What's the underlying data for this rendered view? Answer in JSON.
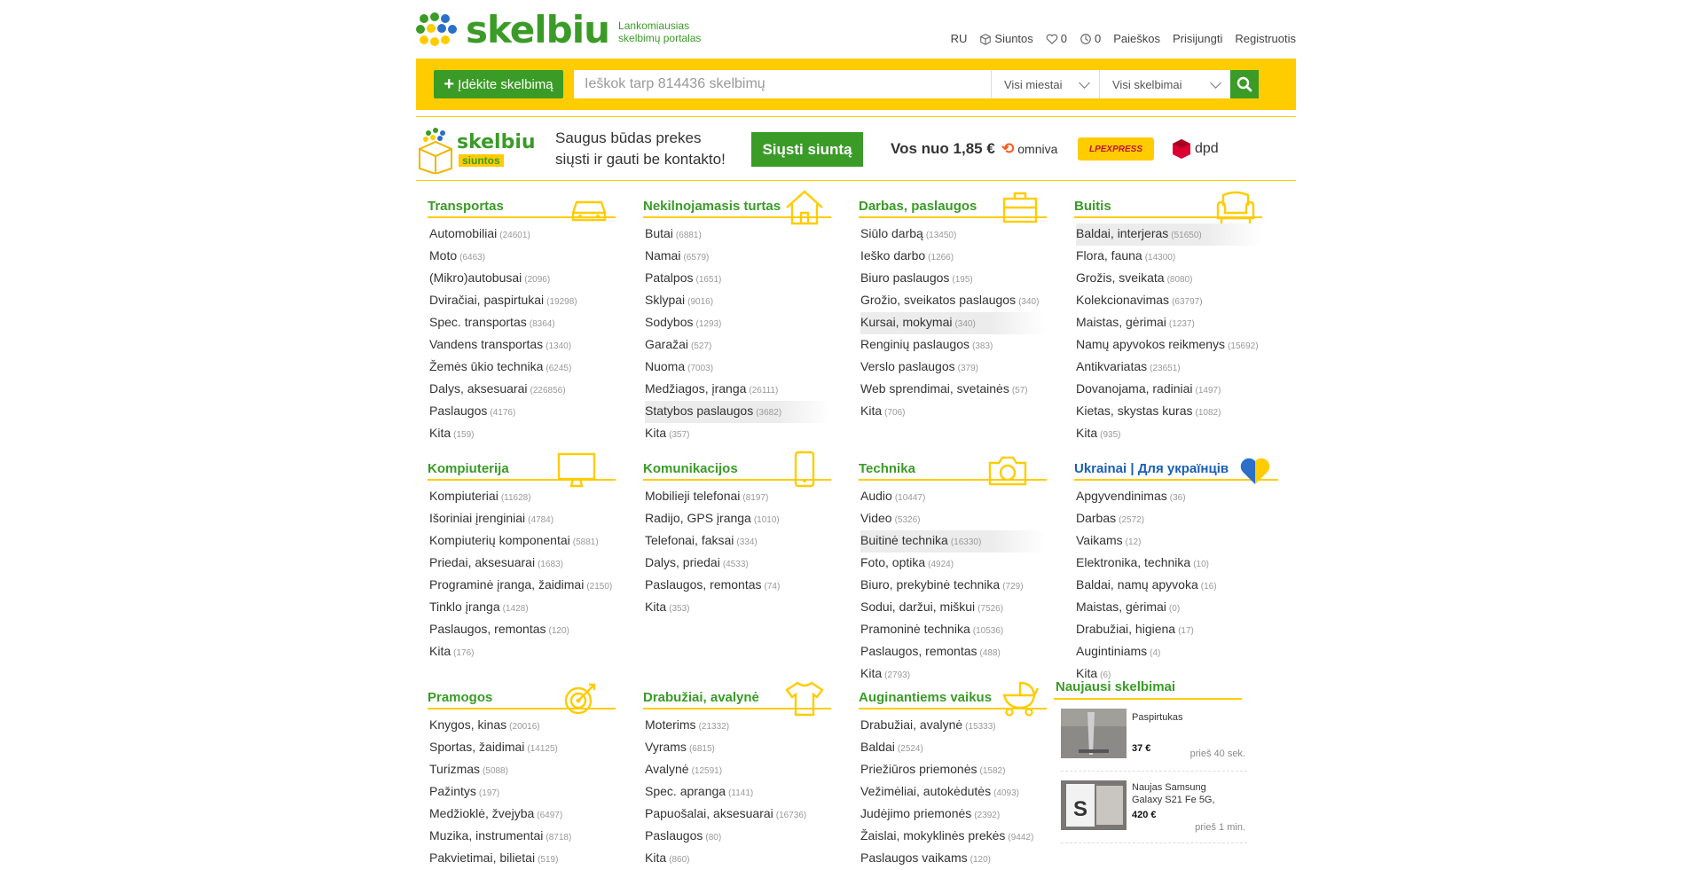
{
  "header": {
    "logo_text": "skelbiu",
    "tagline_1": "Lankomiausias",
    "tagline_2": "skelbimų portalas",
    "nav": {
      "lang": "RU",
      "siuntos": "Siuntos",
      "favorites_count": "0",
      "history_count": "0",
      "searches": "Paieškos",
      "login": "Prisijungti",
      "register": "Registruotis"
    }
  },
  "search": {
    "post_label": "Įdėkite skelbimą",
    "placeholder": "Ieškok tarp 814436 skelbimų",
    "city_select": "Visi miestai",
    "type_select": "Visi skelbimai"
  },
  "promo": {
    "logo_text": "skelbiu",
    "logo_badge": "siuntos",
    "text_1": "Saugus būdas prekes",
    "text_2": "siųsti ir gauti be kontakto!",
    "send_label": "Siųsti siuntą",
    "price": "Vos nuo 1,85 €",
    "carriers": [
      "omniva",
      "LPEXPRESS",
      "dpd"
    ]
  },
  "colors": {
    "green": "#3a9b27",
    "yellow": "#ffcc00",
    "blue": "#1a5fb4"
  },
  "categories": [
    {
      "title": "Transportas",
      "icon": "car-icon",
      "items": [
        [
          "Automobiliai",
          "(24601)"
        ],
        [
          "Moto",
          "(6463)"
        ],
        [
          "(Mikro)autobusai",
          "(2096)"
        ],
        [
          "Dviračiai, paspirtukai",
          "(19298)"
        ],
        [
          "Spec. transportas",
          "(8364)"
        ],
        [
          "Vandens transportas",
          "(1340)"
        ],
        [
          "Žemės ūkio technika",
          "(6245)"
        ],
        [
          "Dalys, aksesuarai",
          "(226856)"
        ],
        [
          "Paslaugos",
          "(4176)"
        ],
        [
          "Kita",
          "(159)"
        ]
      ]
    },
    {
      "title": "Nekilnojamasis turtas",
      "icon": "house-icon",
      "items": [
        [
          "Butai",
          "(6881)"
        ],
        [
          "Namai",
          "(6579)"
        ],
        [
          "Patalpos",
          "(1651)"
        ],
        [
          "Sklypai",
          "(9016)"
        ],
        [
          "Sodybos",
          "(1293)"
        ],
        [
          "Garažai",
          "(527)"
        ],
        [
          "Nuoma",
          "(7003)"
        ],
        [
          "Medžiagos, įranga",
          "(26111)"
        ],
        [
          "Statybos paslaugos",
          "(3682)"
        ],
        [
          "Kita",
          "(357)"
        ]
      ]
    },
    {
      "title": "Darbas, paslaugos",
      "icon": "briefcase-icon",
      "items": [
        [
          "Siūlo darbą",
          "(13450)"
        ],
        [
          "Ieško darbo",
          "(1266)"
        ],
        [
          "Biuro paslaugos",
          "(195)"
        ],
        [
          "Grožio, sveikatos paslaugos",
          "(340)"
        ],
        [
          "Kursai, mokymai",
          "(340)"
        ],
        [
          "Renginių paslaugos",
          "(383)"
        ],
        [
          "Verslo paslaugos",
          "(379)"
        ],
        [
          "Web sprendimai, svetainės",
          "(57)"
        ],
        [
          "Kita",
          "(706)"
        ]
      ]
    },
    {
      "title": "Buitis",
      "icon": "armchair-icon",
      "items": [
        [
          "Baldai, interjeras",
          "(51650)"
        ],
        [
          "Flora, fauna",
          "(14300)"
        ],
        [
          "Grožis, sveikata",
          "(8080)"
        ],
        [
          "Kolekcionavimas",
          "(63797)"
        ],
        [
          "Maistas, gėrimai",
          "(1237)"
        ],
        [
          "Namų apyvokos reikmenys",
          "(15692)"
        ],
        [
          "Antikvariatas",
          "(23651)"
        ],
        [
          "Dovanojama, radiniai",
          "(1497)"
        ],
        [
          "Kietas, skystas kuras",
          "(1082)"
        ],
        [
          "Kita",
          "(935)"
        ]
      ]
    },
    {
      "title": "Kompiuterija",
      "icon": "monitor-icon",
      "items": [
        [
          "Kompiuteriai",
          "(11628)"
        ],
        [
          "Išoriniai įrenginiai",
          "(4784)"
        ],
        [
          "Kompiuterių komponentai",
          "(5881)"
        ],
        [
          "Priedai, aksesuarai",
          "(1683)"
        ],
        [
          "Programinė įranga, žaidimai",
          "(2150)"
        ],
        [
          "Tinklo įranga",
          "(1428)"
        ],
        [
          "Paslaugos, remontas",
          "(120)"
        ],
        [
          "Kita",
          "(176)"
        ]
      ]
    },
    {
      "title": "Komunikacijos",
      "icon": "phone-icon",
      "items": [
        [
          "Mobilieji telefonai",
          "(8197)"
        ],
        [
          "Radijo, GPS įranga",
          "(1010)"
        ],
        [
          "Telefonai, faksai",
          "(334)"
        ],
        [
          "Dalys, priedai",
          "(4533)"
        ],
        [
          "Paslaugos, remontas",
          "(74)"
        ],
        [
          "Kita",
          "(353)"
        ]
      ]
    },
    {
      "title": "Technika",
      "icon": "camera-icon",
      "items": [
        [
          "Audio",
          "(10447)"
        ],
        [
          "Video",
          "(5326)"
        ],
        [
          "Buitinė technika",
          "(16330)"
        ],
        [
          "Foto, optika",
          "(4924)"
        ],
        [
          "Biuro, prekybinė technika",
          "(729)"
        ],
        [
          "Sodui, daržui, miškui",
          "(7526)"
        ],
        [
          "Pramoninė technika",
          "(10536)"
        ],
        [
          "Paslaugos, remontas",
          "(488)"
        ],
        [
          "Kita",
          "(2793)"
        ]
      ]
    },
    {
      "title": "Ukrainai | Для українців",
      "icon": "heart-icon",
      "items": [
        [
          "Apgyvendinimas",
          "(36)"
        ],
        [
          "Darbas",
          "(2572)"
        ],
        [
          "Vaikams",
          "(12)"
        ],
        [
          "Elektronika, technika",
          "(10)"
        ],
        [
          "Baldai, namų apyvoka",
          "(16)"
        ],
        [
          "Maistas, gėrimai",
          "(0)"
        ],
        [
          "Drabužiai, higiena",
          "(17)"
        ],
        [
          "Augintiniams",
          "(4)"
        ],
        [
          "Kita",
          "(6)"
        ]
      ]
    },
    {
      "title": "Pramogos",
      "icon": "target-icon",
      "items": [
        [
          "Knygos, kinas",
          "(20016)"
        ],
        [
          "Sportas, žaidimai",
          "(14125)"
        ],
        [
          "Turizmas",
          "(5088)"
        ],
        [
          "Pažintys",
          "(197)"
        ],
        [
          "Medžioklė, žvejyba",
          "(6497)"
        ],
        [
          "Muzika, instrumentai",
          "(8718)"
        ],
        [
          "Pakvietimai, bilietai",
          "(519)"
        ]
      ]
    },
    {
      "title": "Drabužiai, avalynė",
      "icon": "tshirt-icon",
      "items": [
        [
          "Moterims",
          "(21332)"
        ],
        [
          "Vyrams",
          "(6815)"
        ],
        [
          "Avalynė",
          "(12591)"
        ],
        [
          "Spec. apranga",
          "(1141)"
        ],
        [
          "Papuošalai, aksesuarai",
          "(16736)"
        ],
        [
          "Paslaugos",
          "(80)"
        ],
        [
          "Kita",
          "(860)"
        ]
      ]
    },
    {
      "title": "Auginantiems vaikus",
      "icon": "stroller-icon",
      "items": [
        [
          "Drabužiai, avalynė",
          "(15333)"
        ],
        [
          "Baldai",
          "(2524)"
        ],
        [
          "Priežiūros priemonės",
          "(1582)"
        ],
        [
          "Vežimėliai, autokėdutės",
          "(4093)"
        ],
        [
          "Judėjimo priemonės",
          "(2392)"
        ],
        [
          "Žaislai, mokyklinės prekės",
          "(9442)"
        ],
        [
          "Paslaugos vaikams",
          "(120)"
        ]
      ]
    }
  ],
  "newest": {
    "title": "Naujausi skelbimai",
    "items": [
      {
        "title": "Paspirtukas",
        "price": "37 €",
        "time": "prieš 40 sek."
      },
      {
        "title": "Naujas Samsung Galaxy S21 Fe 5G,",
        "price": "420 €",
        "time": "prieš 1 min."
      }
    ]
  }
}
